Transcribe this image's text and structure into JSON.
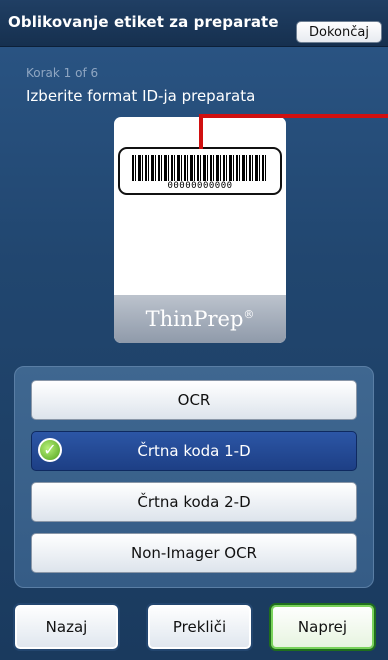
{
  "header": {
    "title": "Oblikovanje etiket za preparate",
    "done_label": "Dokončaj"
  },
  "step": {
    "label": "Korak 1 of 6",
    "instruction": "Izberite format ID-ja preparata"
  },
  "slide": {
    "barcode_digits": "00000000000",
    "brand": "ThinPrep",
    "brand_mark": "®"
  },
  "options": [
    {
      "label": "OCR",
      "selected": false
    },
    {
      "label": "Črtna koda 1-D",
      "selected": true
    },
    {
      "label": "Črtna koda 2-D",
      "selected": false
    },
    {
      "label": "Non-Imager OCR",
      "selected": false
    }
  ],
  "footer": {
    "back_label": "Nazaj",
    "cancel_label": "Prekliči",
    "next_label": "Naprej"
  },
  "colors": {
    "accent_red": "#d01010",
    "selected_blue": "#1d3f85",
    "check_green": "#4fa11a"
  }
}
